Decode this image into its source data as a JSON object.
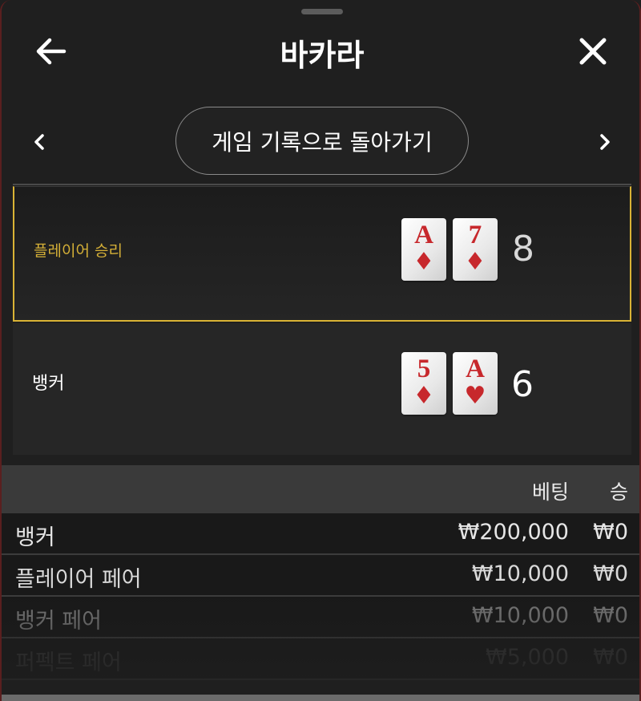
{
  "header": {
    "title": "바카라",
    "back_icon": "arrow-left-icon",
    "close_icon": "close-icon"
  },
  "history_nav": {
    "prev_icon": "chevron-left-icon",
    "next_icon": "chevron-right-icon",
    "back_to_history_label": "게임 기록으로 돌아가기"
  },
  "hands": [
    {
      "label": "플레이어 승리",
      "winner": true,
      "cards": [
        {
          "rank": "A",
          "suit": "♦"
        },
        {
          "rank": "7",
          "suit": "♦"
        }
      ],
      "score": "8"
    },
    {
      "label": "뱅커",
      "winner": false,
      "cards": [
        {
          "rank": "5",
          "suit": "♦"
        },
        {
          "rank": "A",
          "suit": "♥"
        }
      ],
      "score": "6"
    }
  ],
  "bets": {
    "columns": {
      "bet": "베팅",
      "win": "승"
    },
    "rows": [
      {
        "name": "뱅커",
        "amount": "₩200,000",
        "win": "₩0"
      },
      {
        "name": "플레이어 페어",
        "amount": "₩10,000",
        "win": "₩0"
      },
      {
        "name": "뱅커 페어",
        "amount": "₩10,000",
        "win": "₩0"
      },
      {
        "name": "퍼펙트 페어",
        "amount": "₩5,000",
        "win": "₩0"
      }
    ]
  },
  "colors": {
    "accent_gold": "#d9b335",
    "card_red": "#c7282c",
    "background": "#1f1f1f"
  }
}
